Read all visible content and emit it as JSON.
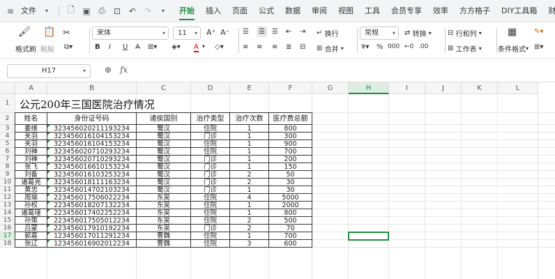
{
  "menubar": {
    "file_label": "文件",
    "tabs": [
      "开始",
      "插入",
      "页面",
      "公式",
      "数据",
      "审阅",
      "视图",
      "工具",
      "会员专享",
      "效率",
      "方方格子",
      "DIY工具箱",
      "财务"
    ],
    "active_tab": "开始"
  },
  "ribbon": {
    "format_painter": "格式刷",
    "paste": "粘贴",
    "font_name": "宋体",
    "font_size": "11",
    "wrap_text": "换行",
    "merge": "合并",
    "number_format": "常规",
    "convert": "转换",
    "row_col": "行和列",
    "worksheet": "工作表",
    "cond_format": "条件格式",
    "bold": "B",
    "italic": "I",
    "underline": "U",
    "font_color_label": "A"
  },
  "formula_bar": {
    "name_box": "H17",
    "formula": ""
  },
  "columns": [
    "A",
    "B",
    "C",
    "D",
    "E",
    "F",
    "G",
    "H",
    "I",
    "J",
    "K",
    "L"
  ],
  "selected_column": "H",
  "selected_row": "17",
  "rows": [
    "1",
    "2",
    "3",
    "4",
    "5",
    "6",
    "7",
    "8",
    "9",
    "10",
    "11",
    "12",
    "13",
    "14",
    "15",
    "16",
    "17",
    "18"
  ],
  "sheet": {
    "title": "公元200年三国医院治疗情况",
    "headers": [
      "姓名",
      "身份证号码",
      "诸侯国别",
      "治疗类型",
      "治疗次数",
      "医疗费总额"
    ],
    "data": [
      [
        "姜维",
        "323456020211193234",
        "蜀汉",
        "住院",
        "1",
        "800"
      ],
      [
        "关羽",
        "323456016104153234",
        "蜀汉",
        "门诊",
        "1",
        "300"
      ],
      [
        "关羽",
        "323456016104153234",
        "蜀汉",
        "住院",
        "1",
        "900"
      ],
      [
        "刘禅",
        "323456020710293234",
        "蜀汉",
        "住院",
        "1",
        "700"
      ],
      [
        "刘禅",
        "323456020710293234",
        "蜀汉",
        "门诊",
        "1",
        "200"
      ],
      [
        "张飞",
        "323456016610153234",
        "蜀汉",
        "门诊",
        "1",
        "150"
      ],
      [
        "刘备",
        "323456016103253234",
        "蜀汉",
        "门诊",
        "2",
        "50"
      ],
      [
        "诸葛亮",
        "323456018111163234",
        "蜀汉",
        "门诊",
        "2",
        "30"
      ],
      [
        "黄忠",
        "323456014702103234",
        "蜀汉",
        "门诊",
        "1",
        "30"
      ],
      [
        "周瑜",
        "223456017506022234",
        "东吴",
        "住院",
        "4",
        "5000"
      ],
      [
        "孙权",
        "223456018207132234",
        "东吴",
        "住院",
        "1",
        "2000"
      ],
      [
        "诸葛瑾",
        "223456017402252234",
        "东吴",
        "住院",
        "1",
        "800"
      ],
      [
        "孙策",
        "223456017505012234",
        "东吴",
        "住院",
        "2",
        "500"
      ],
      [
        "吕蒙",
        "223456017910192234",
        "东吴",
        "门诊",
        "2",
        "70"
      ],
      [
        "郭嘉",
        "123456017011291234",
        "曹魏",
        "住院",
        "1",
        "700"
      ],
      [
        "张辽",
        "123456016902012234",
        "曹魏",
        "住院",
        "3",
        "600"
      ]
    ]
  }
}
